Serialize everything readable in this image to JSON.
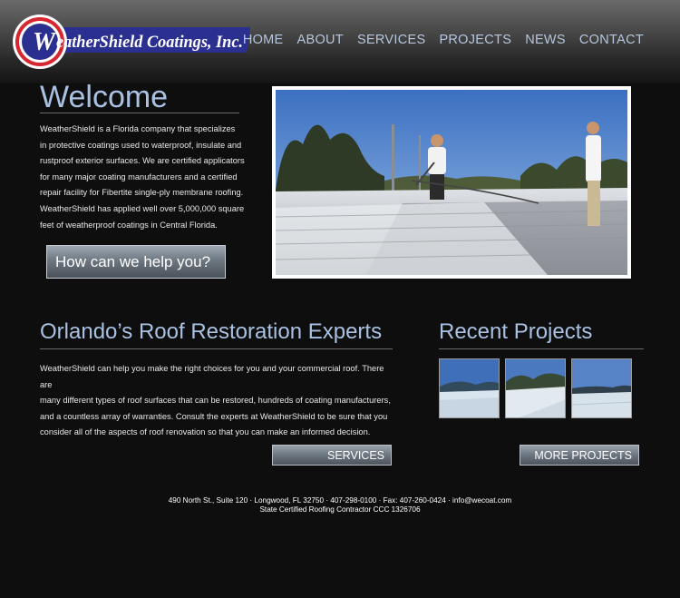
{
  "brand": {
    "name": "WeatherShield Coatings, Inc.",
    "colors": {
      "navy": "#2b2f8f",
      "red": "#d7262f",
      "accent_blue": "#a9c1e2",
      "nav_blue": "#b6c6dc"
    }
  },
  "nav": {
    "items": [
      "HOME",
      "ABOUT",
      "SERVICES",
      "PROJECTS",
      "NEWS",
      "CONTACT"
    ]
  },
  "welcome": {
    "title": "Welcome",
    "lines": [
      "WeatherShield is a Florida company that specializes",
      "in protective coatings used to waterproof, insulate and",
      "rustproof exterior surfaces. We are certified applicators",
      "for many major coating manufacturers and a certified",
      "repair facility for Fibertite single-ply membrane roofing.",
      "WeatherShield has applied well over 5,000,000 square",
      "feet of weatherproof coatings in Central Florida."
    ],
    "cta": "How can we help you?"
  },
  "experts": {
    "title": "Orlando’s Roof Restoration Experts",
    "lines": [
      "WeatherShield can help you make the right choices for you and your commercial roof. There are",
      "many different types of roof surfaces that can be restored, hundreds of coating manufacturers,",
      "and a countless array of warranties. Consult the experts at WeatherShield to be sure that you",
      "consider all of the aspects of roof renovation so that you can make an informed decision."
    ],
    "button": "SERVICES"
  },
  "projects": {
    "title": "Recent Projects",
    "button": "MORE PROJECTS"
  },
  "footer": {
    "line1": "490 North St., Suite 120 · Longwood, FL 32750 · 407-298-0100 · Fax: 407-260-0424 · info@wecoat.com",
    "line2": "State Certified Roofing Contractor CCC 1326706"
  }
}
